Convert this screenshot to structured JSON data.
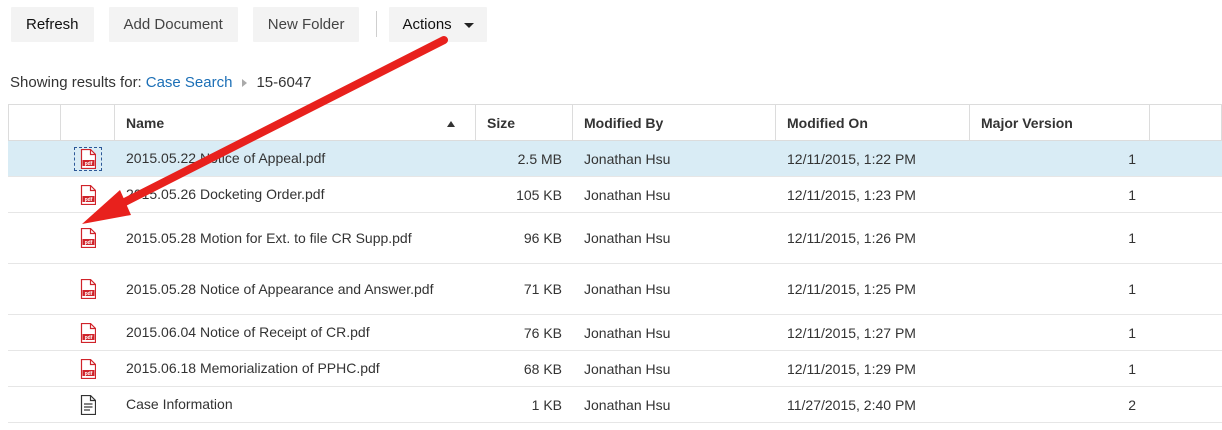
{
  "toolbar": {
    "refresh_label": "Refresh",
    "add_document_label": "Add Document",
    "new_folder_label": "New Folder",
    "actions_label": "Actions"
  },
  "breadcrumb": {
    "prefix": "Showing results for:",
    "link": "Case Search",
    "current": "15-6047"
  },
  "table": {
    "columns": [
      "Name",
      "Size",
      "Modified By",
      "Modified On",
      "Major Version"
    ],
    "sort_column": "Name",
    "sort_direction": "ascending",
    "rows": [
      {
        "icon": "pdf-icon",
        "name": "2015.05.22 Notice of Appeal.pdf",
        "size": "2.5 MB",
        "modified_by": "Jonathan Hsu",
        "modified_on": "12/11/2015, 1:22 PM",
        "version": "1",
        "selected": true
      },
      {
        "icon": "pdf-icon",
        "name": "2015.05.26 Docketing Order.pdf",
        "size": "105 KB",
        "modified_by": "Jonathan Hsu",
        "modified_on": "12/11/2015, 1:23 PM",
        "version": "1"
      },
      {
        "icon": "pdf-icon",
        "name": "2015.05.28 Motion for Ext. to file CR Supp.pdf",
        "size": "96 KB",
        "modified_by": "Jonathan Hsu",
        "modified_on": "12/11/2015, 1:26 PM",
        "version": "1"
      },
      {
        "icon": "pdf-icon",
        "name": "2015.05.28 Notice of Appearance and Answer.pdf",
        "size": "71 KB",
        "modified_by": "Jonathan Hsu",
        "modified_on": "12/11/2015, 1:25 PM",
        "version": "1"
      },
      {
        "icon": "pdf-icon",
        "name": "2015.06.04 Notice of Receipt of CR.pdf",
        "size": "76 KB",
        "modified_by": "Jonathan Hsu",
        "modified_on": "12/11/2015, 1:27 PM",
        "version": "1"
      },
      {
        "icon": "pdf-icon",
        "name": "2015.06.18 Memorialization of PPHC.pdf",
        "size": "68 KB",
        "modified_by": "Jonathan Hsu",
        "modified_on": "12/11/2015, 1:29 PM",
        "version": "1"
      },
      {
        "icon": "document-icon",
        "name": "Case Information",
        "size": "1 KB",
        "modified_by": "Jonathan Hsu",
        "modified_on": "11/27/2015, 2:40 PM",
        "version": "2"
      }
    ]
  },
  "icons": {
    "pdf_label": "pdf"
  },
  "colors": {
    "link": "#1c6fb6",
    "selection": "#d9ecf5",
    "pdf_red": "#d0232a",
    "annotation_arrow": "#e8211d"
  }
}
